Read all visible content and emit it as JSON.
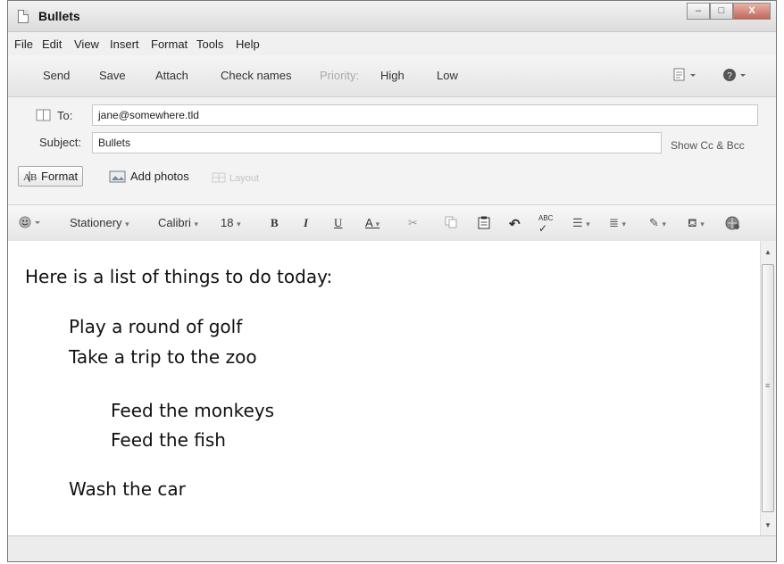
{
  "window": {
    "title": "Bullets",
    "controls": {
      "minimize": "–",
      "maximize": "□",
      "close": "X"
    }
  },
  "menu": [
    "File",
    "Edit",
    "View",
    "Insert",
    "Format",
    "Tools",
    "Help"
  ],
  "commandbar": {
    "send": "Send",
    "save": "Save",
    "attach": "Attach",
    "check_names": "Check names",
    "priority_label": "Priority:",
    "high": "High",
    "low": "Low",
    "icons": [
      "page-options-icon",
      "help-icon"
    ]
  },
  "header": {
    "to_label": "To:",
    "to_value": "jane@somewhere.tld",
    "subject_label": "Subject:",
    "subject_value": "Bullets",
    "show_cc_bcc": "Show Cc & Bcc",
    "format_tab": "Format",
    "add_photos_tab": "Add photos",
    "layout_tab": "Layout"
  },
  "formatbar": {
    "stationery": "Stationery",
    "font": "Calibri",
    "size": "18",
    "bold": "B",
    "italic": "I",
    "underline": "U",
    "font_color": "A",
    "spellcheck": "ABC"
  },
  "body": {
    "intro": "Here is a list of things to do today:",
    "items": [
      {
        "text": "Play a round of golf",
        "level": 1
      },
      {
        "text": "Take a trip to the zoo",
        "level": 1
      },
      {
        "text": "Feed the monkeys",
        "level": 2
      },
      {
        "text": "Feed the fish",
        "level": 2
      },
      {
        "text": "Wash the car",
        "level": 1
      }
    ]
  }
}
